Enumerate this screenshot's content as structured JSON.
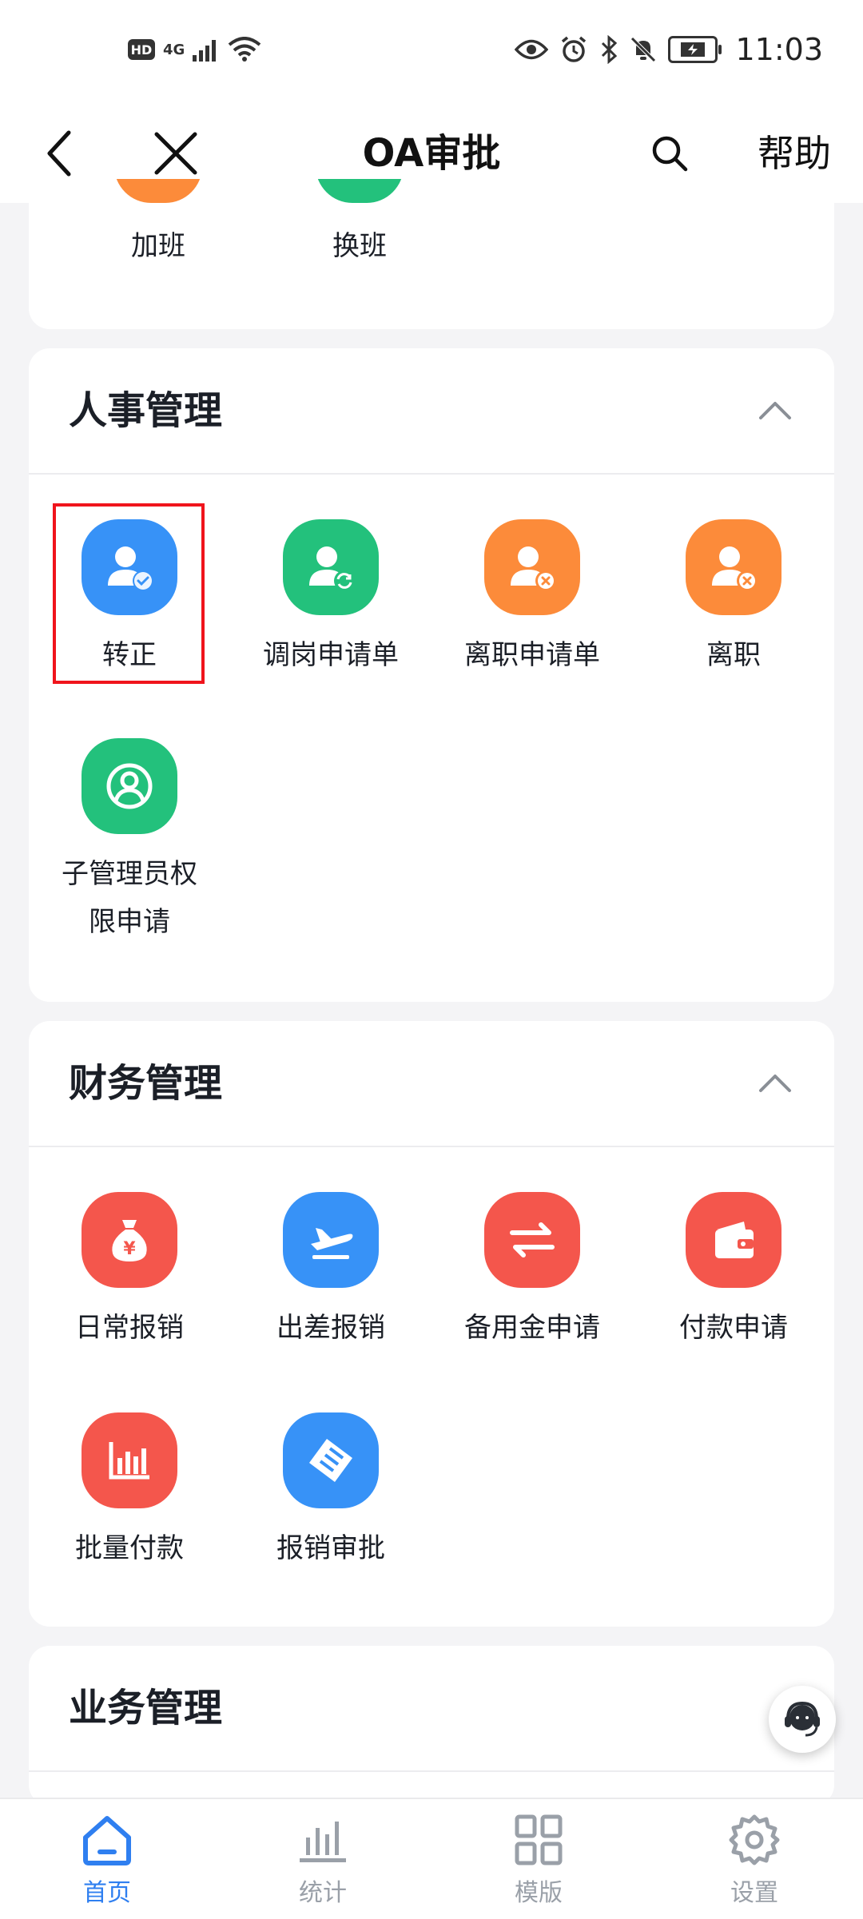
{
  "status_bar": {
    "hd": "HD",
    "network": "4G",
    "time": "11:03"
  },
  "header": {
    "title": "OA审批",
    "help": "帮助"
  },
  "top_partial": {
    "items": [
      {
        "label": "加班",
        "color": "#fc8b3a"
      },
      {
        "label": "换班",
        "color": "#23c17c"
      }
    ]
  },
  "hr_section": {
    "title": "人事管理",
    "items": [
      {
        "label": "转正",
        "icon": "user-check-icon"
      },
      {
        "label": "调岗申请单",
        "icon": "user-transfer-icon"
      },
      {
        "label": "离职申请单",
        "icon": "user-remove-icon"
      },
      {
        "label": "离职",
        "icon": "user-remove-icon"
      },
      {
        "label": "子管理员权限申请",
        "icon": "admin-permission-icon"
      }
    ]
  },
  "finance_section": {
    "title": "财务管理",
    "items": [
      {
        "label": "日常报销",
        "icon": "money-bag-icon"
      },
      {
        "label": "出差报销",
        "icon": "airplane-icon"
      },
      {
        "label": "备用金申请",
        "icon": "exchange-icon"
      },
      {
        "label": "付款申请",
        "icon": "wallet-icon"
      },
      {
        "label": "批量付款",
        "icon": "bar-chart-icon"
      },
      {
        "label": "报销审批",
        "icon": "ticket-icon"
      }
    ]
  },
  "business_section": {
    "title": "业务管理"
  },
  "bottom_nav": {
    "items": [
      {
        "label": "首页",
        "active": true
      },
      {
        "label": "统计",
        "active": false
      },
      {
        "label": "模版",
        "active": false
      },
      {
        "label": "设置",
        "active": false
      }
    ]
  },
  "colors": {
    "accent": "#2f7ff0",
    "highlight": "#f0141c"
  }
}
